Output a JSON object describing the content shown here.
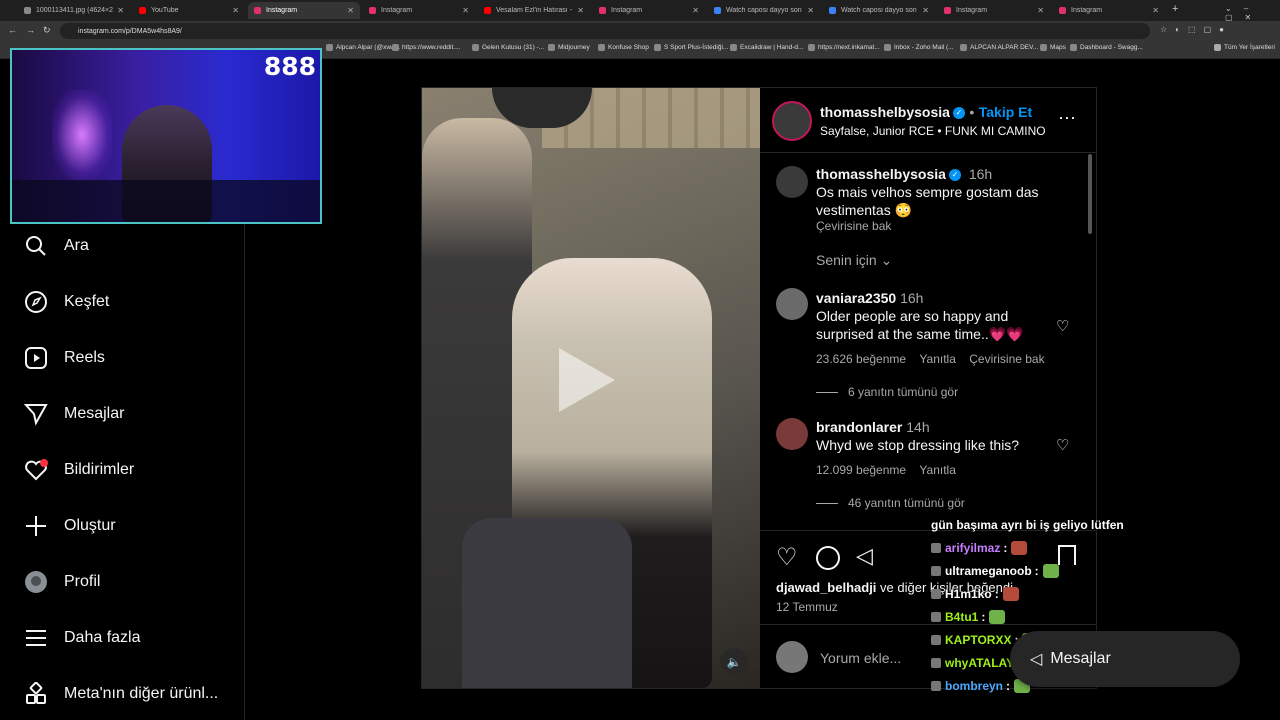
{
  "browser": {
    "tabs": [
      {
        "title": "1000113411.jpg (4624×2604)",
        "color": "#888888"
      },
      {
        "title": "YouTube",
        "color": "#ff0000"
      },
      {
        "title": "Instagram",
        "color": "#e1306c"
      },
      {
        "title": "Instagram",
        "color": "#e1306c"
      },
      {
        "title": "Vesalam Ezl'in Hatırası - YouTube",
        "color": "#ff0000"
      },
      {
        "title": "Instagram",
        "color": "#e1306c"
      },
      {
        "title": "Watch caposi dayyo son 1 kez",
        "color": "#3b82f6"
      },
      {
        "title": "Watch caposi dayyo son 1 kez",
        "color": "#3b82f6"
      },
      {
        "title": "Instagram",
        "color": "#e1306c"
      },
      {
        "title": "Instagram",
        "color": "#e1306c"
      }
    ],
    "url": "instagram.com/p/DMA5w4hs8A9/",
    "bookmarks": [
      "Alpcan Alpar (@xwa...",
      "https://www.reddit....",
      "Gelen Kutusu (31) -...",
      "Midjourney",
      "Konfuse Shop",
      "S Sport Plus-İstediği...",
      "Excalidraw | Hand-d...",
      "https://next.inkamat...",
      "Inbox - Zoho Mail (...",
      "ALPCAN ALPAR DEV...",
      "Maps",
      "Dashboard - Swagg..."
    ],
    "all_bookmarks": "Tüm Yer İşaretleri"
  },
  "webcam": {
    "viewers": "888"
  },
  "sidebar": {
    "items": [
      {
        "label": "Ara",
        "icon": "search-icon"
      },
      {
        "label": "Keşfet",
        "icon": "compass-icon"
      },
      {
        "label": "Reels",
        "icon": "reels-icon"
      },
      {
        "label": "Mesajlar",
        "icon": "send-icon"
      },
      {
        "label": "Bildirimler",
        "icon": "heart-icon"
      },
      {
        "label": "Oluştur",
        "icon": "plus-icon"
      },
      {
        "label": "Profil",
        "icon": "avatar-icon"
      },
      {
        "label": "Daha fazla",
        "icon": "menu-icon"
      },
      {
        "label": "Meta'nın diğer ürünl...",
        "icon": "meta-apps-icon"
      }
    ]
  },
  "post": {
    "author": "thomasshelbysosia",
    "follow": "Takip Et",
    "dot": "•",
    "subtitle": "Sayfalse, Junior RCE • FUNK MI CAMINO",
    "caption_time": "16h",
    "caption": "Os mais velhos sempre gostam das vestimentas 😳",
    "translate": "Çevirisine bak",
    "for_you": "Senin için",
    "comments": [
      {
        "user": "vaniara2350",
        "time": "16h",
        "text": "Older people are so happy and surprised at the same time..💗💗",
        "likes": "23.626 beğenme",
        "reply": "Yanıtla",
        "translate": "Çevirisine bak",
        "view_replies": "6 yanıtın tümünü gör"
      },
      {
        "user": "brandonlarer",
        "time": "14h",
        "text": "Whyd we stop dressing like this?",
        "likes": "12.099 beğenme",
        "reply": "Yanıtla",
        "view_replies": "46 yanıtın tümünü gör"
      }
    ],
    "liked_by_user": "djawad_belhadji",
    "liked_by_rest": "ve diğer kişiler beğendi",
    "date": "12 Temmuz",
    "comment_placeholder": "Yorum ekle..."
  },
  "chat": {
    "messages": [
      {
        "user": "",
        "text": "gün başıma ayrı bi iş geliyo lütfen",
        "color": "#ffffff"
      },
      {
        "user": "arifyilmaz",
        "text": ":",
        "color": "#c77dff"
      },
      {
        "user": "ultrameganoob",
        "text": ":",
        "color": "#ffffff"
      },
      {
        "user": "H1m1ko",
        "text": ":",
        "color": "#ffffff"
      },
      {
        "user": "B4tu1",
        "text": ":",
        "color": "#9ef01a"
      },
      {
        "user": "KAPTORXX",
        "text": ":",
        "color": "#9ef01a"
      },
      {
        "user": "whyATALAY",
        "text": ":",
        "color": "#9ef01a"
      },
      {
        "user": "bombreyn",
        "text": ":",
        "color": "#4ea8ff"
      }
    ]
  },
  "messages_bar": {
    "label": "Mesajlar"
  }
}
